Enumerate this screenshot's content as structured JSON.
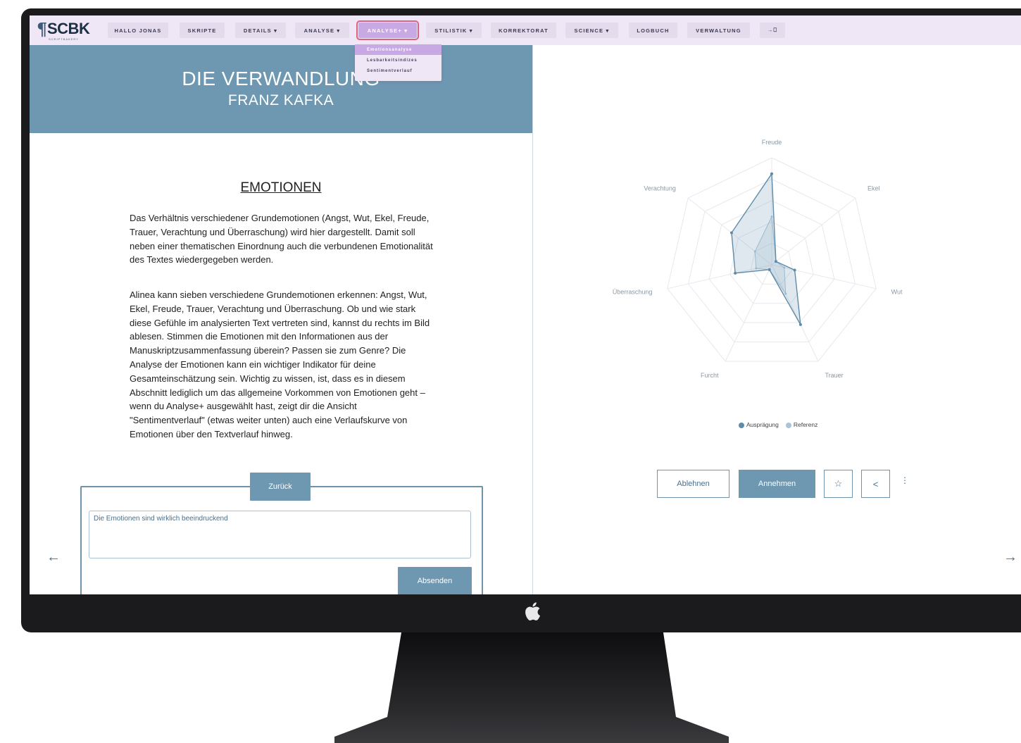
{
  "nav": {
    "logo_text": "SCBK",
    "logo_sub": "SCRIPTBAKERY",
    "items": [
      {
        "label": "HALLO JONAS"
      },
      {
        "label": "SKRIPTE"
      },
      {
        "label": "DETAILS ▾"
      },
      {
        "label": "ANALYSE ▾"
      },
      {
        "label": "ANALYSE+ ▾"
      },
      {
        "label": "STILISTIK ▾"
      },
      {
        "label": "KORREKTORAT"
      },
      {
        "label": "SCIENCE ▾"
      },
      {
        "label": "LOGBUCH"
      },
      {
        "label": "VERWALTUNG"
      },
      {
        "label": "→⎕"
      }
    ],
    "dropdown": [
      "Emotionsanalyse",
      "Lesbarkeitsindizes",
      "Sentimentverlauf"
    ]
  },
  "book": {
    "title": "DIE VERWANDLUNG",
    "author": "FRANZ KAFKA"
  },
  "section": {
    "title": "EMOTIONEN",
    "para1": "Das Verhältnis verschiedener Grundemotionen (Angst, Wut, Ekel, Freude, Trauer, Verachtung und Überraschung) wird hier dargestellt. Damit soll neben einer thematischen Einordnung auch die verbundenen Emotionalität des Textes wiedergegeben werden.",
    "para2": "Alinea kann sieben verschiedene Grundemotionen erkennen: Angst, Wut, Ekel, Freude, Trauer, Verachtung und Überraschung. Ob und wie stark diese Gefühle im analysierten Text vertreten sind, kannst du rechts im Bild ablesen. Stimmen die Emotionen mit den Informationen aus der Manuskriptzusammenfassung überein? Passen sie zum Genre? Die Analyse der Emotionen kann ein wichtiger Indikator für deine Gesamteinschätzung sein. Wichtig zu wissen, ist, dass es in diesem Abschnitt lediglich um das allgemeine Vorkommen von Emotionen geht – wenn du Analyse+ ausgewählt hast, zeigt dir die Ansicht \"Sentimentverlauf\" (etwas weiter unten) auch eine Verlaufskurve von Emotionen über den Textverlauf hinweg."
  },
  "comment": {
    "back_label": "Zurück",
    "text": "Die Emotionen sind wirklich beeindruckend",
    "submit_label": "Absenden"
  },
  "arrows": {
    "left": "←",
    "right": "→"
  },
  "chart_data": {
    "type": "radar",
    "axes": [
      "Freude",
      "Ekel",
      "Wut",
      "Trauer",
      "Furcht",
      "Überraschung",
      "Verachtung"
    ],
    "series": [
      {
        "name": "Ausprägung",
        "values": [
          0.85,
          0.05,
          0.22,
          0.62,
          0.05,
          0.35,
          0.48
        ],
        "color": "#5f8aa8"
      },
      {
        "name": "Referenz",
        "values": [
          0.45,
          0.05,
          0.12,
          0.3,
          0.05,
          0.15,
          0.2
        ],
        "color": "#a9c4d6"
      }
    ],
    "rings": 5,
    "legend": "bottom"
  },
  "actions": {
    "reject_label": "Ablehnen",
    "accept_label": "Annehmen",
    "star_icon": "☆",
    "share_icon": "<",
    "more_icon": "⋮"
  },
  "colors": {
    "primary": "#6e97b1",
    "nav_bg": "#efe6f6",
    "active": "#c9a9e3"
  }
}
